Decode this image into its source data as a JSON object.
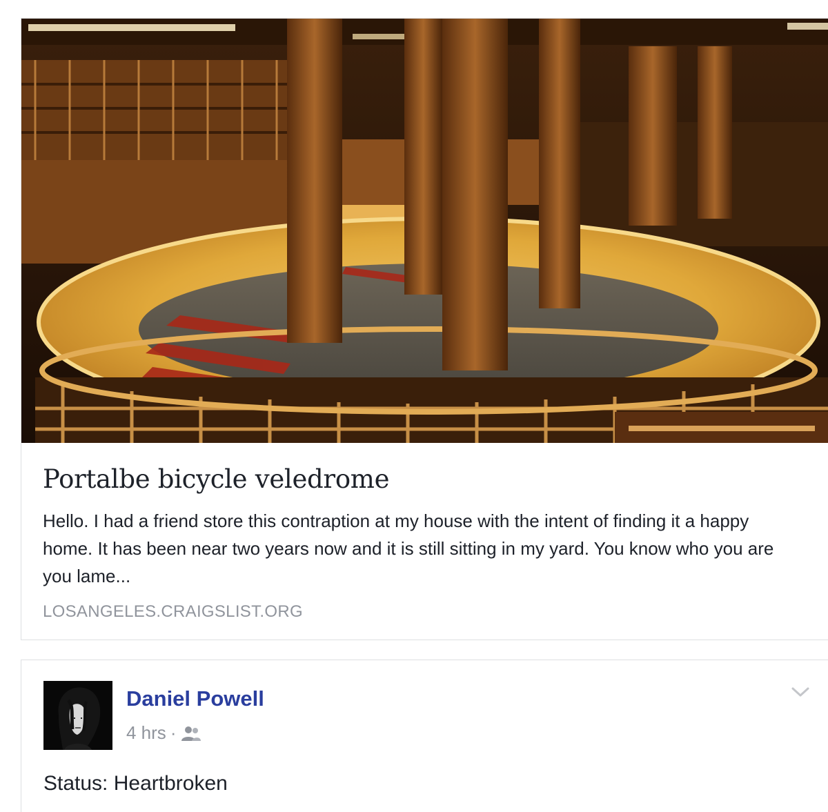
{
  "link_preview": {
    "title": "Portalbe bicycle veledrome",
    "description": "Hello. I had a friend store this contraption at my house with the intent of finding it a happy home. It has been near two years now and it is still sitting in my yard. You know who you are you lame...",
    "domain": "LOSANGELES.CRAIGSLIST.ORG"
  },
  "post": {
    "author": "Daniel Powell",
    "time": "4 hrs",
    "separator": "·",
    "audience_icon": "friends-icon",
    "menu_icon": "chevron-down-icon",
    "status": "Status: Heartbroken"
  },
  "colors": {
    "author_link": "#2a3e9e",
    "muted_text": "#90949c",
    "body_text": "#1d2129",
    "card_border": "#dddfe2"
  }
}
